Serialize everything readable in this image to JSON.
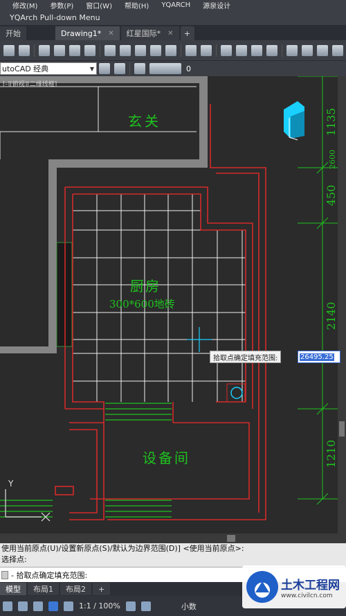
{
  "menubar": {
    "items": [
      "修改(M)",
      "参数(P)",
      "窗口(W)",
      "帮助(H)",
      "YQARCH",
      "源泉设计"
    ]
  },
  "yqarch_menu": {
    "title": "YQArch Pull-down Menu"
  },
  "doc_tabs": {
    "items": [
      {
        "label": "开始",
        "closable": false
      },
      {
        "label": "Drawing1*",
        "closable": true
      },
      {
        "label": "红星国际*",
        "closable": true
      }
    ],
    "new_tab": "+"
  },
  "workspace": {
    "value": "utoCAD 经典",
    "layer": "0"
  },
  "viewport_label": "[-][俯视][二维线框]",
  "room_labels": {
    "entrance": "玄关",
    "kitchen": "厨房",
    "kitchen_tile": "300*600地砖",
    "equipment": "设备间"
  },
  "dimensions": [
    "1135",
    "2600",
    "450",
    "2140",
    "1210"
  ],
  "prompt": {
    "label": "拾取点确定填充范围:",
    "value": "26495.25"
  },
  "command": {
    "history": [
      "使用当前原点(U)/设置新原点(S)/默认为边界范围(D)] <使用当前原点>:",
      "选择点:"
    ],
    "current": "- 拾取点确定填充范围:"
  },
  "layout_tabs": [
    "模型",
    "布局1",
    "布局2",
    "+"
  ],
  "status": {
    "scale": "1:1 / 100%",
    "right_label": "小数"
  },
  "watermark": {
    "title": "土木工程网",
    "url": "www.civilcn.com"
  },
  "colors": {
    "wall": "#d42a2a",
    "grid": "#f0f0f0",
    "label": "#1fc21f",
    "cyan": "#19d0ff",
    "dim": "#1fc21f",
    "wall_fill": "#858585"
  }
}
